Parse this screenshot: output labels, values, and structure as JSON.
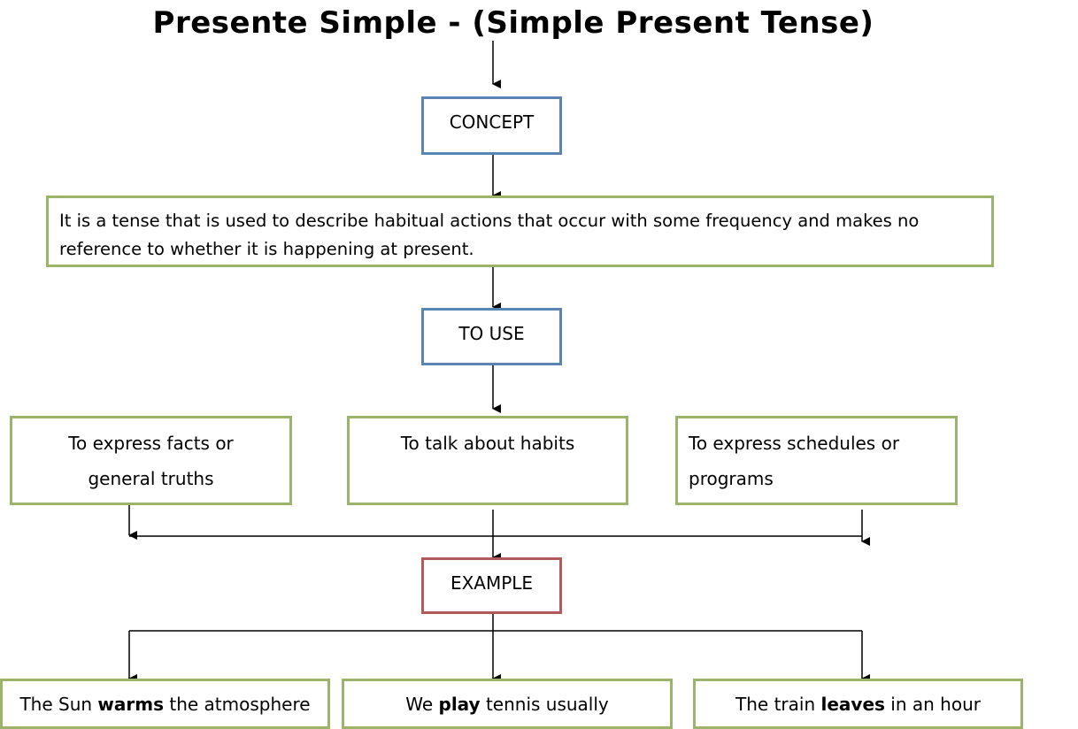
{
  "title": "Presente Simple - (Simple Present Tense)",
  "concept": {
    "label": "CONCEPT",
    "definition": "It is a tense that is used to describe habitual actions that occur with some frequency and makes no reference to whether it is happening at present."
  },
  "to_use": {
    "label": "TO USE",
    "items": [
      {
        "line1": "To express facts or",
        "line2": "general truths"
      },
      {
        "line1": "To talk about habits",
        "line2": ""
      },
      {
        "line1": "To express schedules or",
        "line2": "programs"
      }
    ]
  },
  "example": {
    "label": "EXAMPLE",
    "items": [
      {
        "before": "The Sun ",
        "verb": "warms",
        "after": " the atmosphere"
      },
      {
        "before": "We ",
        "verb": "play",
        "after": " tennis usually"
      },
      {
        "before": "The train ",
        "verb": "leaves",
        "after": " in an hour"
      }
    ]
  },
  "colors": {
    "concept_border": "#5b84b3",
    "content_border": "#9bb36b",
    "example_border": "#b05a5c"
  }
}
